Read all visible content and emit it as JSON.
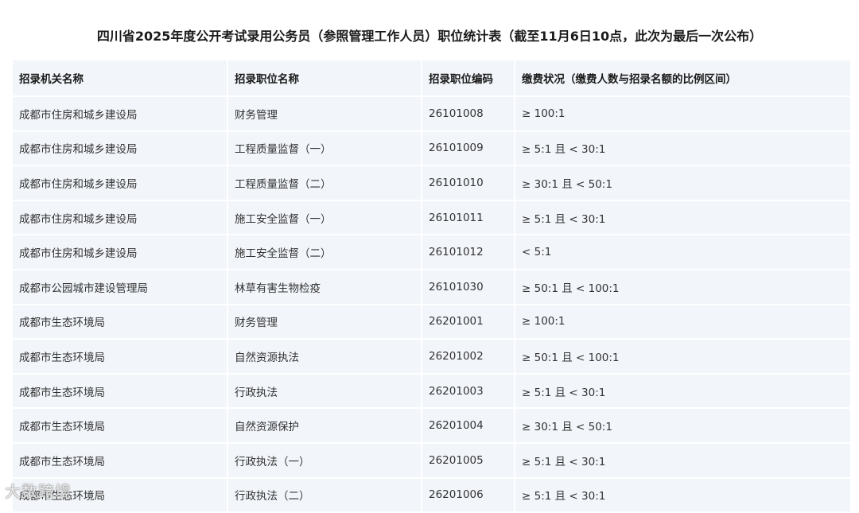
{
  "title": "四川省2025年度公开考试录用公务员（参照管理工作人员）职位统计表（截至11月6日10点，此次为最后一次公布）",
  "table": {
    "headers": [
      "招录机关名称",
      "招录职位名称",
      "招录职位编码",
      "缴费状况（缴费人数与招录名额的比例区间）"
    ],
    "rows": [
      [
        "成都市住房和城乡建设局",
        "财务管理",
        "26101008",
        "≥ 100:1"
      ],
      [
        "成都市住房和城乡建设局",
        "工程质量监督（一）",
        "26101009",
        "≥ 5:1 且 < 30:1"
      ],
      [
        "成都市住房和城乡建设局",
        "工程质量监督（二）",
        "26101010",
        "≥ 30:1 且 < 50:1"
      ],
      [
        "成都市住房和城乡建设局",
        "施工安全监督（一）",
        "26101011",
        "≥ 5:1 且 < 30:1"
      ],
      [
        "成都市住房和城乡建设局",
        "施工安全监督（二）",
        "26101012",
        "< 5:1"
      ],
      [
        "成都市公园城市建设管理局",
        "林草有害生物检疫",
        "26101030",
        "≥ 50:1 且 < 100:1"
      ],
      [
        "成都市生态环境局",
        "财务管理",
        "26201001",
        "≥ 100:1"
      ],
      [
        "成都市生态环境局",
        "自然资源执法",
        "26201002",
        "≥ 50:1 且 < 100:1"
      ],
      [
        "成都市生态环境局",
        "行政执法",
        "26201003",
        "≥ 5:1 且 < 30:1"
      ],
      [
        "成都市生态环境局",
        "自然资源保护",
        "26201004",
        "≥ 30:1 且 < 50:1"
      ],
      [
        "成都市生态环境局",
        "行政执法（一）",
        "26201005",
        "≥ 5:1 且 < 30:1"
      ],
      [
        "成都市生态环境局",
        "行政执法（二）",
        "26201006",
        "≥ 5:1 且 < 30:1"
      ]
    ]
  },
  "watermark": "大数跨境"
}
